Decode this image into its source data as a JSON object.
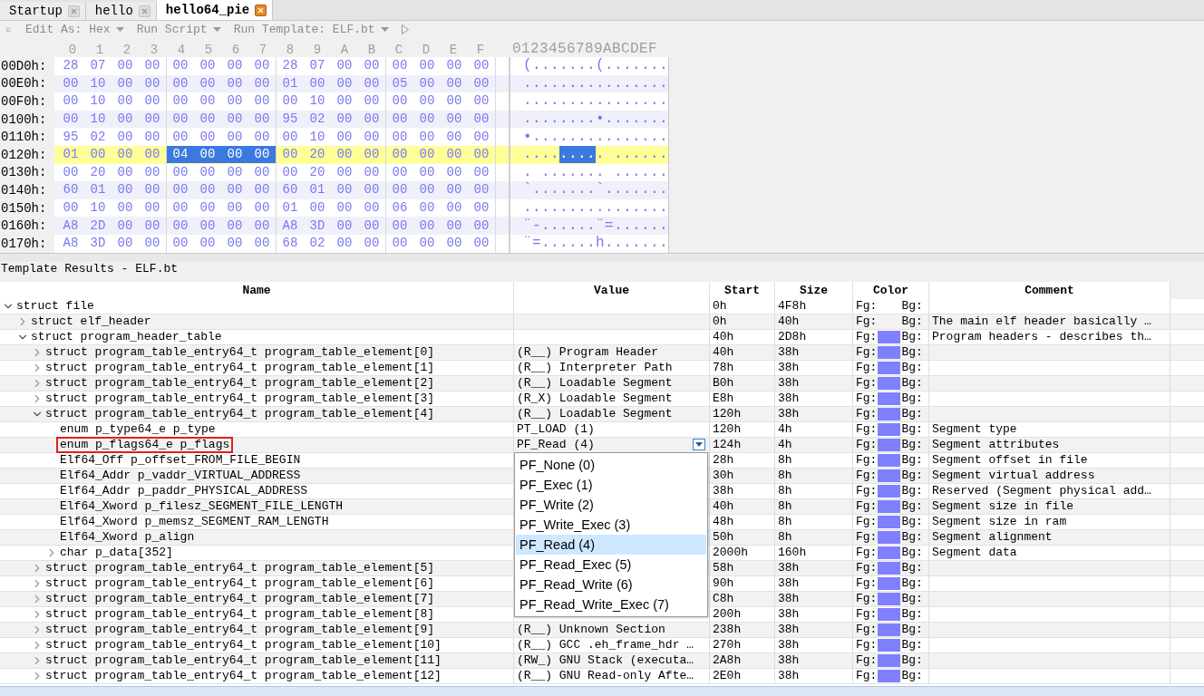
{
  "tabs": [
    {
      "label": "Startup",
      "selected": false
    },
    {
      "label": "hello",
      "selected": false
    },
    {
      "label": "hello64_pie",
      "selected": true
    }
  ],
  "toolbar": [
    {
      "kind": "dropdown",
      "label": "Edit As: Hex"
    },
    {
      "kind": "dropdown",
      "label": "Run Script"
    },
    {
      "kind": "dropdown",
      "label": "Run Template: ELF.bt"
    },
    {
      "kind": "run"
    }
  ],
  "hex_view": {
    "columns": [
      "0",
      "1",
      "2",
      "3",
      "4",
      "5",
      "6",
      "7",
      "8",
      "9",
      "A",
      "B",
      "C",
      "D",
      "E",
      "F"
    ],
    "ascii_header": "0123456789ABCDEF",
    "rows": [
      {
        "offset": "00D0h:",
        "current": false,
        "ascii": "(.......(.......",
        "bytes": [
          {
            "value": "28",
            "selected": false
          },
          {
            "value": "07",
            "selected": false
          },
          {
            "value": "00",
            "selected": false
          },
          {
            "value": "00",
            "selected": false
          },
          {
            "value": "00",
            "selected": false
          },
          {
            "value": "00",
            "selected": false
          },
          {
            "value": "00",
            "selected": false
          },
          {
            "value": "00",
            "selected": false
          },
          {
            "value": "28",
            "selected": false
          },
          {
            "value": "07",
            "selected": false
          },
          {
            "value": "00",
            "selected": false
          },
          {
            "value": "00",
            "selected": false
          },
          {
            "value": "00",
            "selected": false
          },
          {
            "value": "00",
            "selected": false
          },
          {
            "value": "00",
            "selected": false
          },
          {
            "value": "00",
            "selected": false
          }
        ]
      },
      {
        "offset": "00E0h:",
        "current": false,
        "ascii": "................",
        "bytes": [
          {
            "value": "00",
            "selected": false
          },
          {
            "value": "10",
            "selected": false
          },
          {
            "value": "00",
            "selected": false
          },
          {
            "value": "00",
            "selected": false
          },
          {
            "value": "00",
            "selected": false
          },
          {
            "value": "00",
            "selected": false
          },
          {
            "value": "00",
            "selected": false
          },
          {
            "value": "00",
            "selected": false
          },
          {
            "value": "01",
            "selected": false
          },
          {
            "value": "00",
            "selected": false
          },
          {
            "value": "00",
            "selected": false
          },
          {
            "value": "00",
            "selected": false
          },
          {
            "value": "05",
            "selected": false
          },
          {
            "value": "00",
            "selected": false
          },
          {
            "value": "00",
            "selected": false
          },
          {
            "value": "00",
            "selected": false
          }
        ]
      },
      {
        "offset": "00F0h:",
        "current": false,
        "ascii": "................",
        "bytes": [
          {
            "value": "00",
            "selected": false
          },
          {
            "value": "10",
            "selected": false
          },
          {
            "value": "00",
            "selected": false
          },
          {
            "value": "00",
            "selected": false
          },
          {
            "value": "00",
            "selected": false
          },
          {
            "value": "00",
            "selected": false
          },
          {
            "value": "00",
            "selected": false
          },
          {
            "value": "00",
            "selected": false
          },
          {
            "value": "00",
            "selected": false
          },
          {
            "value": "10",
            "selected": false
          },
          {
            "value": "00",
            "selected": false
          },
          {
            "value": "00",
            "selected": false
          },
          {
            "value": "00",
            "selected": false
          },
          {
            "value": "00",
            "selected": false
          },
          {
            "value": "00",
            "selected": false
          },
          {
            "value": "00",
            "selected": false
          }
        ]
      },
      {
        "offset": "0100h:",
        "current": false,
        "ascii": "........•.......",
        "bytes": [
          {
            "value": "00",
            "selected": false
          },
          {
            "value": "10",
            "selected": false
          },
          {
            "value": "00",
            "selected": false
          },
          {
            "value": "00",
            "selected": false
          },
          {
            "value": "00",
            "selected": false
          },
          {
            "value": "00",
            "selected": false
          },
          {
            "value": "00",
            "selected": false
          },
          {
            "value": "00",
            "selected": false
          },
          {
            "value": "95",
            "selected": false
          },
          {
            "value": "02",
            "selected": false
          },
          {
            "value": "00",
            "selected": false
          },
          {
            "value": "00",
            "selected": false
          },
          {
            "value": "00",
            "selected": false
          },
          {
            "value": "00",
            "selected": false
          },
          {
            "value": "00",
            "selected": false
          },
          {
            "value": "00",
            "selected": false
          }
        ]
      },
      {
        "offset": "0110h:",
        "current": false,
        "ascii": "•...............",
        "bytes": [
          {
            "value": "95",
            "selected": false
          },
          {
            "value": "02",
            "selected": false
          },
          {
            "value": "00",
            "selected": false
          },
          {
            "value": "00",
            "selected": false
          },
          {
            "value": "00",
            "selected": false
          },
          {
            "value": "00",
            "selected": false
          },
          {
            "value": "00",
            "selected": false
          },
          {
            "value": "00",
            "selected": false
          },
          {
            "value": "00",
            "selected": false
          },
          {
            "value": "10",
            "selected": false
          },
          {
            "value": "00",
            "selected": false
          },
          {
            "value": "00",
            "selected": false
          },
          {
            "value": "00",
            "selected": false
          },
          {
            "value": "00",
            "selected": false
          },
          {
            "value": "00",
            "selected": false
          },
          {
            "value": "00",
            "selected": false
          }
        ]
      },
      {
        "offset": "0120h:",
        "current": true,
        "ascii": "......... ......",
        "bytes": [
          {
            "value": "01",
            "selected": false
          },
          {
            "value": "00",
            "selected": false
          },
          {
            "value": "00",
            "selected": false
          },
          {
            "value": "00",
            "selected": false
          },
          {
            "value": "04",
            "selected": true
          },
          {
            "value": "00",
            "selected": true
          },
          {
            "value": "00",
            "selected": true
          },
          {
            "value": "00",
            "selected": true
          },
          {
            "value": "00",
            "selected": false
          },
          {
            "value": "20",
            "selected": false
          },
          {
            "value": "00",
            "selected": false
          },
          {
            "value": "00",
            "selected": false
          },
          {
            "value": "00",
            "selected": false
          },
          {
            "value": "00",
            "selected": false
          },
          {
            "value": "00",
            "selected": false
          },
          {
            "value": "00",
            "selected": false
          }
        ]
      },
      {
        "offset": "0130h:",
        "current": false,
        "ascii": ". ....... ......",
        "bytes": [
          {
            "value": "00",
            "selected": false
          },
          {
            "value": "20",
            "selected": false
          },
          {
            "value": "00",
            "selected": false
          },
          {
            "value": "00",
            "selected": false
          },
          {
            "value": "00",
            "selected": false
          },
          {
            "value": "00",
            "selected": false
          },
          {
            "value": "00",
            "selected": false
          },
          {
            "value": "00",
            "selected": false
          },
          {
            "value": "00",
            "selected": false
          },
          {
            "value": "20",
            "selected": false
          },
          {
            "value": "00",
            "selected": false
          },
          {
            "value": "00",
            "selected": false
          },
          {
            "value": "00",
            "selected": false
          },
          {
            "value": "00",
            "selected": false
          },
          {
            "value": "00",
            "selected": false
          },
          {
            "value": "00",
            "selected": false
          }
        ]
      },
      {
        "offset": "0140h:",
        "current": false,
        "ascii": "`.......`.......",
        "bytes": [
          {
            "value": "60",
            "selected": false
          },
          {
            "value": "01",
            "selected": false
          },
          {
            "value": "00",
            "selected": false
          },
          {
            "value": "00",
            "selected": false
          },
          {
            "value": "00",
            "selected": false
          },
          {
            "value": "00",
            "selected": false
          },
          {
            "value": "00",
            "selected": false
          },
          {
            "value": "00",
            "selected": false
          },
          {
            "value": "60",
            "selected": false
          },
          {
            "value": "01",
            "selected": false
          },
          {
            "value": "00",
            "selected": false
          },
          {
            "value": "00",
            "selected": false
          },
          {
            "value": "00",
            "selected": false
          },
          {
            "value": "00",
            "selected": false
          },
          {
            "value": "00",
            "selected": false
          },
          {
            "value": "00",
            "selected": false
          }
        ]
      },
      {
        "offset": "0150h:",
        "current": false,
        "ascii": "................",
        "bytes": [
          {
            "value": "00",
            "selected": false
          },
          {
            "value": "10",
            "selected": false
          },
          {
            "value": "00",
            "selected": false
          },
          {
            "value": "00",
            "selected": false
          },
          {
            "value": "00",
            "selected": false
          },
          {
            "value": "00",
            "selected": false
          },
          {
            "value": "00",
            "selected": false
          },
          {
            "value": "00",
            "selected": false
          },
          {
            "value": "01",
            "selected": false
          },
          {
            "value": "00",
            "selected": false
          },
          {
            "value": "00",
            "selected": false
          },
          {
            "value": "00",
            "selected": false
          },
          {
            "value": "06",
            "selected": false
          },
          {
            "value": "00",
            "selected": false
          },
          {
            "value": "00",
            "selected": false
          },
          {
            "value": "00",
            "selected": false
          }
        ]
      },
      {
        "offset": "0160h:",
        "current": false,
        "ascii": "¨-......¨=......",
        "bytes": [
          {
            "value": "A8",
            "selected": false
          },
          {
            "value": "2D",
            "selected": false
          },
          {
            "value": "00",
            "selected": false
          },
          {
            "value": "00",
            "selected": false
          },
          {
            "value": "00",
            "selected": false
          },
          {
            "value": "00",
            "selected": false
          },
          {
            "value": "00",
            "selected": false
          },
          {
            "value": "00",
            "selected": false
          },
          {
            "value": "A8",
            "selected": false
          },
          {
            "value": "3D",
            "selected": false
          },
          {
            "value": "00",
            "selected": false
          },
          {
            "value": "00",
            "selected": false
          },
          {
            "value": "00",
            "selected": false
          },
          {
            "value": "00",
            "selected": false
          },
          {
            "value": "00",
            "selected": false
          },
          {
            "value": "00",
            "selected": false
          }
        ]
      },
      {
        "offset": "0170h:",
        "current": false,
        "ascii": "¨=......h.......",
        "bytes": [
          {
            "value": "A8",
            "selected": false
          },
          {
            "value": "3D",
            "selected": false
          },
          {
            "value": "00",
            "selected": false
          },
          {
            "value": "00",
            "selected": false
          },
          {
            "value": "00",
            "selected": false
          },
          {
            "value": "00",
            "selected": false
          },
          {
            "value": "00",
            "selected": false
          },
          {
            "value": "00",
            "selected": false
          },
          {
            "value": "68",
            "selected": false
          },
          {
            "value": "02",
            "selected": false
          },
          {
            "value": "00",
            "selected": false
          },
          {
            "value": "00",
            "selected": false
          },
          {
            "value": "00",
            "selected": false
          },
          {
            "value": "00",
            "selected": false
          },
          {
            "value": "00",
            "selected": false
          },
          {
            "value": "00",
            "selected": false
          }
        ]
      }
    ]
  },
  "template_results": {
    "title": "Template Results - ELF.bt",
    "columns": [
      "Name",
      "Value",
      "Start",
      "Size",
      "Color",
      "Comment"
    ],
    "rows": [
      {
        "name": "struct file",
        "start": "0h",
        "size": "4F8h",
        "fg": "Fg:",
        "bg": "Bg:",
        "selected": false,
        "expanded": true,
        "children": [
          {
            "name": "struct elf_header",
            "start": "0h",
            "size": "40h",
            "fg": "Fg:",
            "bg": "Bg:",
            "comment": "The main elf header basically …",
            "selected": false,
            "expanded": false
          },
          {
            "name": "struct program_header_table",
            "start": "40h",
            "size": "2D8h",
            "fg": "Fg:",
            "color": "#8080ff",
            "bg": "Bg:",
            "comment": "Program headers - describes th…",
            "selected": false,
            "expanded": true,
            "children": [
              {
                "name": "struct program_table_entry64_t program_table_element[0]",
                "value": "(R__) Program Header",
                "start": "40h",
                "size": "38h",
                "fg": "Fg:",
                "color": "#8080ff",
                "bg": "Bg:",
                "selected": false,
                "expanded": false
              },
              {
                "name": "struct program_table_entry64_t program_table_element[1]",
                "value": "(R__) Interpreter Path",
                "start": "78h",
                "size": "38h",
                "fg": "Fg:",
                "color": "#8080ff",
                "bg": "Bg:",
                "selected": false,
                "expanded": false
              },
              {
                "name": "struct program_table_entry64_t program_table_element[2]",
                "value": "(R__) Loadable Segment",
                "start": "B0h",
                "size": "38h",
                "fg": "Fg:",
                "color": "#8080ff",
                "bg": "Bg:",
                "selected": false,
                "expanded": false
              },
              {
                "name": "struct program_table_entry64_t program_table_element[3]",
                "value": "(R_X) Loadable Segment",
                "start": "E8h",
                "size": "38h",
                "fg": "Fg:",
                "color": "#8080ff",
                "bg": "Bg:",
                "selected": false,
                "expanded": false
              },
              {
                "name": "struct program_table_entry64_t program_table_element[4]",
                "value": "(R__) Loadable Segment",
                "start": "120h",
                "size": "38h",
                "fg": "Fg:",
                "color": "#8080ff",
                "bg": "Bg:",
                "selected": false,
                "expanded": true,
                "children": [
                  {
                    "name": "enum p_type64_e p_type",
                    "value": "PT_LOAD (1)",
                    "start": "120h",
                    "size": "4h",
                    "fg": "Fg:",
                    "color": "#8080ff",
                    "bg": "Bg:",
                    "comment": "Segment type",
                    "selected": false
                  },
                  {
                    "name": "enum p_flags64_e p_flags",
                    "value": "PF_Read (4)",
                    "start": "124h",
                    "size": "4h",
                    "fg": "Fg:",
                    "color": "#8080ff",
                    "bg": "Bg:",
                    "comment": "Segment attributes",
                    "selected": true,
                    "dropdown": {
                      "options": [
                        {
                          "label": "PF_None (0)",
                          "selected": false
                        },
                        {
                          "label": "PF_Exec (1)",
                          "selected": false
                        },
                        {
                          "label": "PF_Write (2)",
                          "selected": false
                        },
                        {
                          "label": "PF_Write_Exec (3)",
                          "selected": false
                        },
                        {
                          "label": "PF_Read (4)",
                          "selected": true
                        },
                        {
                          "label": "PF_Read_Exec (5)",
                          "selected": false
                        },
                        {
                          "label": "PF_Read_Write (6)",
                          "selected": false
                        },
                        {
                          "label": "PF_Read_Write_Exec (7)",
                          "selected": false
                        }
                      ]
                    }
                  },
                  {
                    "name": "Elf64_Off p_offset_FROM_FILE_BEGIN",
                    "start": "28h",
                    "size": "8h",
                    "fg": "Fg:",
                    "color": "#8080ff",
                    "bg": "Bg:",
                    "comment": "Segment offset in file",
                    "selected": false
                  },
                  {
                    "name": "Elf64_Addr p_vaddr_VIRTUAL_ADDRESS",
                    "start": "30h",
                    "size": "8h",
                    "fg": "Fg:",
                    "color": "#8080ff",
                    "bg": "Bg:",
                    "comment": "Segment virtual address",
                    "selected": false
                  },
                  {
                    "name": "Elf64_Addr p_paddr_PHYSICAL_ADDRESS",
                    "start": "38h",
                    "size": "8h",
                    "fg": "Fg:",
                    "color": "#8080ff",
                    "bg": "Bg:",
                    "comment": "Reserved (Segment physical add…",
                    "selected": false
                  },
                  {
                    "name": "Elf64_Xword p_filesz_SEGMENT_FILE_LENGTH",
                    "start": "40h",
                    "size": "8h",
                    "fg": "Fg:",
                    "color": "#8080ff",
                    "bg": "Bg:",
                    "comment": "Segment size in file",
                    "selected": false
                  },
                  {
                    "name": "Elf64_Xword p_memsz_SEGMENT_RAM_LENGTH",
                    "start": "48h",
                    "size": "8h",
                    "fg": "Fg:",
                    "color": "#8080ff",
                    "bg": "Bg:",
                    "comment": "Segment size in ram",
                    "selected": false
                  },
                  {
                    "name": "Elf64_Xword p_align",
                    "start": "50h",
                    "size": "8h",
                    "fg": "Fg:",
                    "color": "#8080ff",
                    "bg": "Bg:",
                    "comment": "Segment alignment",
                    "selected": false
                  },
                  {
                    "name": "char p_data[352]",
                    "start": "2000h",
                    "size": "160h",
                    "fg": "Fg:",
                    "color": "#8080ff",
                    "bg": "Bg:",
                    "comment": "Segment data",
                    "selected": false,
                    "expanded": false
                  }
                ]
              },
              {
                "name": "struct program_table_entry64_t program_table_element[5]",
                "start": "58h",
                "size": "38h",
                "fg": "Fg:",
                "color": "#8080ff",
                "bg": "Bg:",
                "selected": false,
                "expanded": false
              },
              {
                "name": "struct program_table_entry64_t program_table_element[6]",
                "start": "90h",
                "size": "38h",
                "fg": "Fg:",
                "color": "#8080ff",
                "bg": "Bg:",
                "selected": false,
                "expanded": false
              },
              {
                "name": "struct program_table_entry64_t program_table_element[7]",
                "start": "C8h",
                "size": "38h",
                "fg": "Fg:",
                "color": "#8080ff",
                "bg": "Bg:",
                "selected": false,
                "expanded": false
              },
              {
                "name": "struct program_table_entry64_t program_table_element[8]",
                "start": "200h",
                "size": "38h",
                "fg": "Fg:",
                "color": "#8080ff",
                "bg": "Bg:",
                "selected": false,
                "expanded": false
              },
              {
                "name": "struct program_table_entry64_t program_table_element[9]",
                "value": "(R__) Unknown Section",
                "start": "238h",
                "size": "38h",
                "fg": "Fg:",
                "color": "#8080ff",
                "bg": "Bg:",
                "selected": false,
                "expanded": false
              },
              {
                "name": "struct program_table_entry64_t program_table_element[10]",
                "value": "(R__) GCC .eh_frame_hdr …",
                "start": "270h",
                "size": "38h",
                "fg": "Fg:",
                "color": "#8080ff",
                "bg": "Bg:",
                "selected": false,
                "expanded": false
              },
              {
                "name": "struct program_table_entry64_t program_table_element[11]",
                "value": "(RW_) GNU Stack (executa…",
                "start": "2A8h",
                "size": "38h",
                "fg": "Fg:",
                "color": "#8080ff",
                "bg": "Bg:",
                "selected": false,
                "expanded": false
              },
              {
                "name": "struct program_table_entry64_t program_table_element[12]",
                "value": "(R__) GNU Read-only Afte…",
                "start": "2E0h",
                "size": "38h",
                "fg": "Fg:",
                "color": "#8080ff",
                "bg": "Bg:",
                "selected": false,
                "expanded": false
              }
            ]
          }
        ]
      }
    ]
  }
}
